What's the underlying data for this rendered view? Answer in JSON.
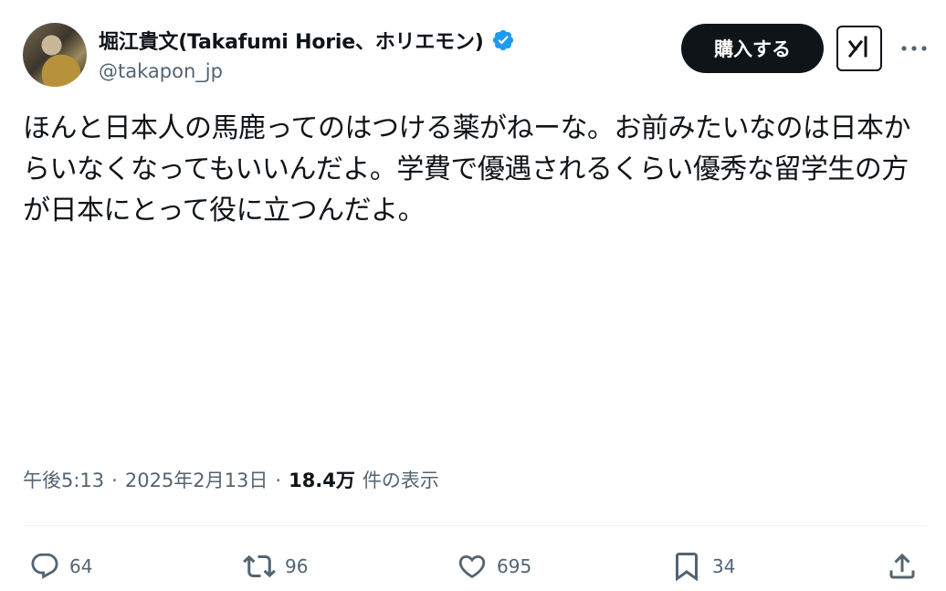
{
  "author": {
    "display_name": "堀江貴文(Takafumi Horie、ホリエモン)",
    "handle": "@takapon_jp",
    "avatar_icon": "user-avatar-photo",
    "verified_icon": "verified-badge-icon"
  },
  "header": {
    "buy_label": "購入する",
    "grok_icon": "grok-icon",
    "more_icon": "more-icon"
  },
  "tweet": {
    "text": "ほんと日本人の馬鹿ってのはつける薬がねーな。お前みたいなのは日本からいなくなってもいいんだよ。学費で優遇されるくらい優秀な留学生の方が日本にとって役に立つんだよ。"
  },
  "meta": {
    "time": "午後5:13",
    "separator": "·",
    "date": "2025年2月13日",
    "views_count": "18.4万",
    "views_label": "件の表示"
  },
  "actions": {
    "replies": "64",
    "retweets": "96",
    "likes": "695",
    "bookmarks": "34"
  },
  "colors": {
    "text_primary": "#0f1419",
    "text_secondary": "#536471",
    "verified_blue": "#1d9bf0",
    "divider": "#eff3f4"
  }
}
